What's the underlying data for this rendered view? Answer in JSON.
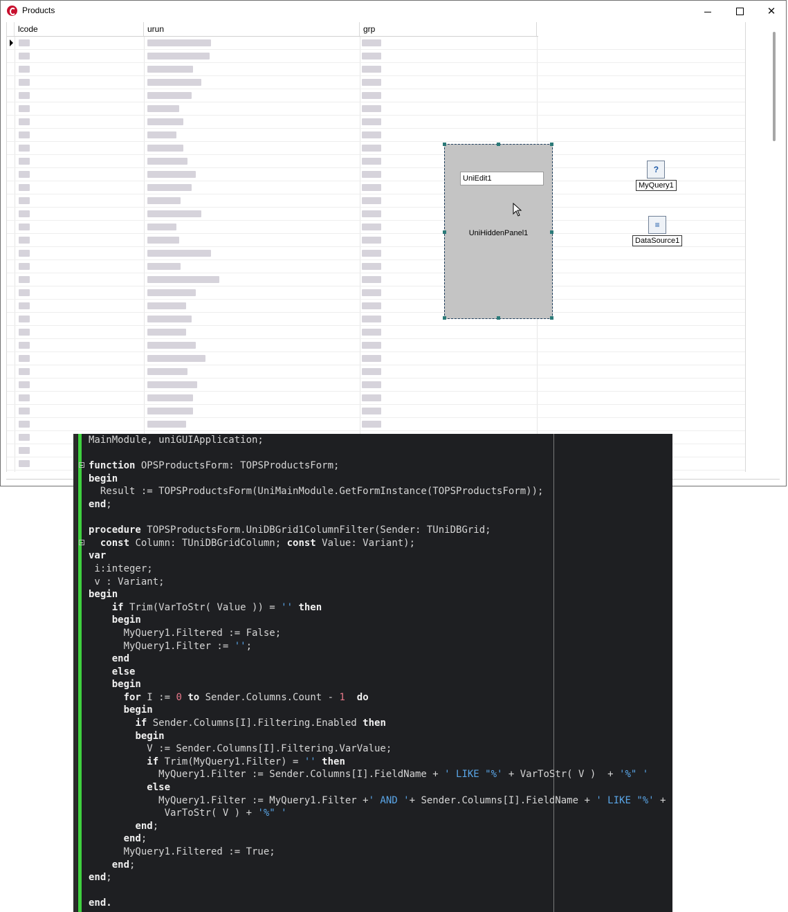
{
  "window": {
    "title": "Products",
    "colors": {
      "titlebar": "#ffffff",
      "border": "#6f6f6f"
    }
  },
  "grid": {
    "columns": [
      "lcode",
      "urun",
      "grp"
    ],
    "row_count": 35
  },
  "panel": {
    "edit_text": "UniEdit1",
    "caption": "UniHiddenPanel1"
  },
  "components": {
    "query_label": "MyQuery1",
    "datasource_label": "DataSource1"
  },
  "editor": {
    "colors": {
      "background": "#1e1f22",
      "modified_bar": "#3fd03f",
      "string": "#5aa6e8",
      "number": "#e8788a"
    },
    "lines": [
      "MainModule, uniGUIApplication;",
      "",
      "function OPSProductsForm: TOPSProductsForm;",
      "begin",
      "  Result := TOPSProductsForm(UniMainModule.GetFormInstance(TOPSProductsForm));",
      "end;",
      "",
      "procedure TOPSProductsForm.UniDBGrid1ColumnFilter(Sender: TUniDBGrid;",
      "  const Column: TUniDBGridColumn; const Value: Variant);",
      "var",
      " i:integer;",
      " v : Variant;",
      "begin",
      "    if Trim(VarToStr( Value )) = '' then",
      "    begin",
      "      MyQuery1.Filtered := False;",
      "      MyQuery1.Filter := '';",
      "    end",
      "    else",
      "    begin",
      "      for I := 0 to Sender.Columns.Count - 1  do",
      "      begin",
      "        if Sender.Columns[I].Filtering.Enabled then",
      "        begin",
      "          V := Sender.Columns[I].Filtering.VarValue;",
      "          if Trim(MyQuery1.Filter) = '' then",
      "            MyQuery1.Filter := Sender.Columns[I].FieldName + ' LIKE \"%' + VarToStr( V )  + '%\" '",
      "          else",
      "            MyQuery1.Filter := MyQuery1.Filter +' AND '+ Sender.Columns[I].FieldName + ' LIKE \"%' +",
      "             VarToStr( V ) + '%\" '",
      "        end;",
      "      end;",
      "      MyQuery1.Filtered := True;",
      "    end;",
      "end;",
      "",
      "end."
    ]
  }
}
